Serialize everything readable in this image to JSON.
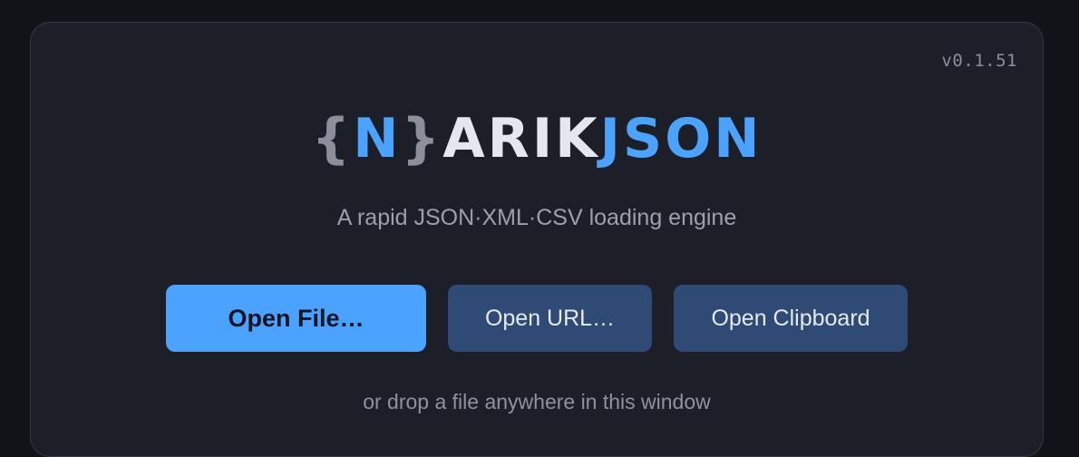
{
  "app": {
    "version": "v0.1.51",
    "logo": {
      "brace_open": "{",
      "n": "N",
      "brace_close": "}",
      "arik": "ARIK",
      "json": "JSON"
    },
    "tagline": "A rapid JSON·XML·CSV loading engine"
  },
  "actions": {
    "open_file_label": "Open File…",
    "open_url_label": "Open URL…",
    "open_clipboard_label": "Open Clipboard"
  },
  "hint": {
    "drop_text": "or drop a file anywhere in this window"
  },
  "colors": {
    "accent": "#4ba3ff",
    "secondary_button": "#2e4a75",
    "panel": "#1c1f27",
    "background": "#111318"
  }
}
